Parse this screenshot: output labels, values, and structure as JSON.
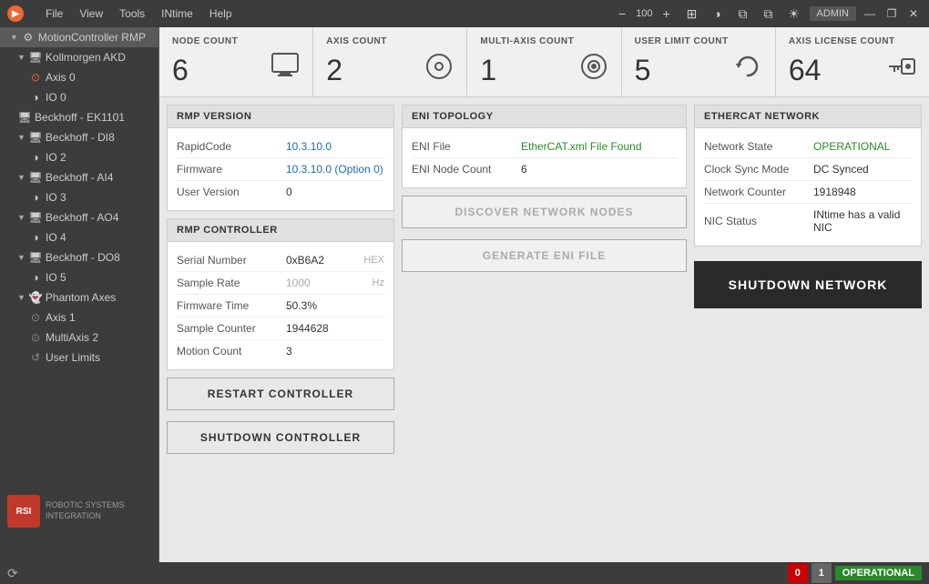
{
  "menuBar": {
    "logoText": "RSI",
    "menus": [
      "File",
      "View",
      "Tools",
      "INtime",
      "Help"
    ],
    "zoom": "100",
    "adminLabel": "ADMIN",
    "windowButtons": [
      "—",
      "❐",
      "✕"
    ],
    "icons": [
      "⊞",
      "◑",
      "⧉",
      "⧉",
      "☀"
    ]
  },
  "sidebar": {
    "items": [
      {
        "label": "MotionController RMP",
        "level": 0,
        "hasArrow": true,
        "iconType": "gear",
        "selected": true
      },
      {
        "label": "Kollmorgen AKD",
        "level": 1,
        "hasArrow": true,
        "iconType": "device"
      },
      {
        "label": "Axis 0",
        "level": 2,
        "hasArrow": false,
        "iconType": "axis-red"
      },
      {
        "label": "IO 0",
        "level": 2,
        "hasArrow": false,
        "iconType": "io"
      },
      {
        "label": "Beckhoff - EK1101",
        "level": 1,
        "hasArrow": false,
        "iconType": "device"
      },
      {
        "label": "Beckhoff - DI8",
        "level": 1,
        "hasArrow": true,
        "iconType": "device"
      },
      {
        "label": "IO 2",
        "level": 2,
        "hasArrow": false,
        "iconType": "io"
      },
      {
        "label": "Beckhoff - AI4",
        "level": 1,
        "hasArrow": true,
        "iconType": "device"
      },
      {
        "label": "IO 3",
        "level": 2,
        "hasArrow": false,
        "iconType": "io"
      },
      {
        "label": "Beckhoff - AO4",
        "level": 1,
        "hasArrow": true,
        "iconType": "device"
      },
      {
        "label": "IO 4",
        "level": 2,
        "hasArrow": false,
        "iconType": "io"
      },
      {
        "label": "Beckhoff - DO8",
        "level": 1,
        "hasArrow": true,
        "iconType": "device"
      },
      {
        "label": "IO 5",
        "level": 2,
        "hasArrow": false,
        "iconType": "io"
      },
      {
        "label": "Phantom Axes",
        "level": 1,
        "hasArrow": true,
        "iconType": "phantom"
      },
      {
        "label": "Axis 1",
        "level": 2,
        "hasArrow": false,
        "iconType": "axis-gray"
      },
      {
        "label": "MultiAxis 2",
        "level": 2,
        "hasArrow": false,
        "iconType": "multi"
      },
      {
        "label": "User Limits",
        "level": 2,
        "hasArrow": false,
        "iconType": "user-limits"
      }
    ]
  },
  "stats": [
    {
      "label": "NODE COUNT",
      "value": "6",
      "icon": "🖥"
    },
    {
      "label": "AXIS COUNT",
      "value": "2",
      "icon": "⊙"
    },
    {
      "label": "MULTI-AXIS COUNT",
      "value": "1",
      "icon": "⊙"
    },
    {
      "label": "USER LIMIT COUNT",
      "value": "5",
      "icon": "↺"
    },
    {
      "label": "AXIS LICENSE COUNT",
      "value": "64",
      "icon": "🔑"
    }
  ],
  "rmpVersion": {
    "header": "RMP VERSION",
    "rows": [
      {
        "label": "RapidCode",
        "value": "10.3.10.0",
        "style": "blue"
      },
      {
        "label": "Firmware",
        "value": "10.3.10.0 (Option 0)",
        "style": "blue"
      },
      {
        "label": "User Version",
        "value": "0",
        "style": "normal"
      }
    ]
  },
  "rmpController": {
    "header": "RMP CONTROLLER",
    "rows": [
      {
        "label": "Serial Number",
        "value": "0xB6A2",
        "suffix": "HEX"
      },
      {
        "label": "Sample Rate",
        "value": "1000",
        "suffix": "Hz",
        "style": "muted"
      },
      {
        "label": "Firmware Time",
        "value": "50.3%",
        "style": "normal"
      },
      {
        "label": "Sample Counter",
        "value": "1944628",
        "style": "normal"
      },
      {
        "label": "Motion Count",
        "value": "3",
        "style": "normal"
      }
    ],
    "buttons": {
      "restart": "RESTART CONTROLLER",
      "shutdown": "SHUTDOWN CONTROLLER"
    }
  },
  "eniTopology": {
    "header": "ENI TOPOLOGY",
    "rows": [
      {
        "label": "ENI File",
        "value": "EtherCAT.xml File Found",
        "style": "green"
      },
      {
        "label": "ENI Node Count",
        "value": "6",
        "style": "normal"
      }
    ],
    "buttons": {
      "discover": "DISCOVER NETWORK NODES",
      "generate": "GENERATE ENI FILE"
    }
  },
  "ethercatNetwork": {
    "header": "ETHERCAT NETWORK",
    "rows": [
      {
        "label": "Network State",
        "value": "OPERATIONAL",
        "style": "green"
      },
      {
        "label": "Clock Sync Mode",
        "value": "DC Synced",
        "style": "normal"
      },
      {
        "label": "Network Counter",
        "value": "1918948",
        "style": "normal"
      },
      {
        "label": "NIC Status",
        "value": "INtime has a valid NIC",
        "style": "normal"
      }
    ],
    "shutdownButton": "SHUTDOWN NETWORK"
  },
  "statusBar": {
    "num0": "0",
    "num1": "1",
    "statusText": "OPERATIONAL",
    "icon": "⟳"
  },
  "rsiLogo": "ROBOTIC SYSTEMS\nINTEGRATION"
}
